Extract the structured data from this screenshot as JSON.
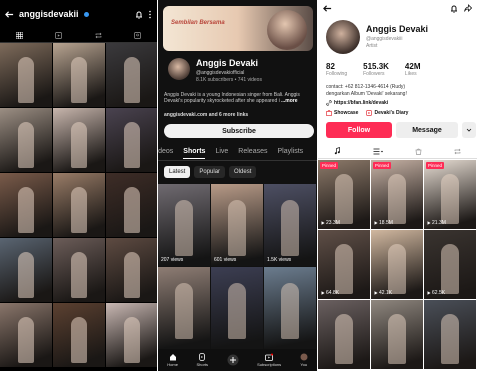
{
  "instagram": {
    "username": "anggisdevakii",
    "tab_colors": [
      "#2c2c2c",
      "#fff"
    ],
    "grid": [
      [
        "#7e6b5b",
        "#b8a491",
        "#3b3a3d"
      ],
      [
        "#9c8f84",
        "#c8b6ad",
        "#4a4350"
      ],
      [
        "#7a5b4a",
        "#9a7d68",
        "#3e2d27"
      ],
      [
        "#5a6572",
        "#6c5d59",
        "#5e4b42"
      ],
      [
        "#8a766b",
        "#5c4131",
        "#c9b8b3"
      ]
    ]
  },
  "youtube": {
    "banner_text": "Sembilan Bersama",
    "channel_name": "Anggis Devaki",
    "handle": "@anggisdevakiofficial",
    "stats": "8.1K subscribers • 741 videos",
    "description": "Anggis Devaki is a young Indonesian singer from Bali. Anggis Devaki's popularity skyrocketed after she appeared i",
    "more": "...more",
    "links": "anggisdevaki.com and 6 more links",
    "subscribe": "Subscribe",
    "tabs": [
      "Videos",
      "Shorts",
      "Live",
      "Releases",
      "Playlists"
    ],
    "active_tab": "Shorts",
    "filters": [
      "Latest",
      "Popular",
      "Oldest"
    ],
    "shorts_views": [
      "207 views",
      "601 views",
      "1.5K views"
    ],
    "nav": [
      "Home",
      "Shorts",
      "",
      "Subscriptions",
      "You"
    ],
    "thumb_colors": [
      "#6f6a70",
      "#b79a87",
      "#4d4f63",
      "#8e7d74",
      "#3c3e52",
      "#6b7c8e"
    ]
  },
  "tiktok": {
    "name": "Anggis Devaki",
    "handle": "@anggisdevakiii",
    "role": "Artist",
    "stats": [
      {
        "value": "82",
        "label": "Following"
      },
      {
        "value": "515.3K",
        "label": "Followers"
      },
      {
        "value": "42M",
        "label": "Likes"
      }
    ],
    "contact": "contact: +62 812-1346-4614 (Rudy)",
    "bio": "dengarkan Album 'Devaki' sekarang!",
    "link": "https://bfan.link/devaki",
    "showcase": "Showcase",
    "diary": "Devaki's Diary",
    "follow": "Follow",
    "message": "Message",
    "grid_badges": [
      "Pinned",
      "Pinned",
      "Pinned"
    ],
    "grid_counts": [
      "23.3M",
      "18.5M",
      "21.3M",
      "64.8K",
      "42.1K",
      "62.5K"
    ],
    "grid_colors": [
      "#8d7a6a",
      "#c7b2a5",
      "#e7ddd3",
      "#5f4f47",
      "#d1b8a0",
      "#3a3430",
      "#6a6060",
      "#8f877f",
      "#4a4f58"
    ]
  }
}
